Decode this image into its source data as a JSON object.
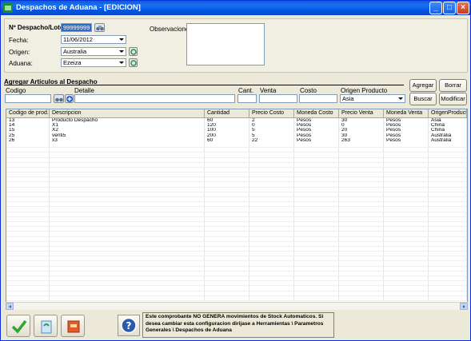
{
  "window": {
    "title": "Despachos de Aduana - [EDICION]",
    "controls": [
      "minimize",
      "maximize",
      "close"
    ]
  },
  "header": {
    "despacho_label": "Nº Despacho/Lote:",
    "despacho_value": "99999999",
    "fecha_label": "Fecha:",
    "fecha_value": "11/06/2012",
    "origen_label": "Origen:",
    "origen_value": "Australia",
    "aduana_label": "Aduana:",
    "aduana_value": "Ezeiza",
    "observaciones_label": "Observaciones:",
    "observaciones_value": ""
  },
  "agregar": {
    "section_title": "Agregar Articulos al Despacho",
    "codigo_label": "Codigo",
    "codigo_value": "",
    "detalle_label": "Detalle",
    "detalle_value": "",
    "cant_label": "Cant.",
    "cant_value": "",
    "venta_label": "Venta",
    "venta_value": "",
    "costo_label": "Costo",
    "costo_value": "",
    "origen_producto_label": "Origen Producto",
    "origen_producto_value": "Asia",
    "buttons": {
      "agregar": "Agregar",
      "borrar": "Borrar",
      "buscar": "Buscar",
      "modificar": "Modificar"
    }
  },
  "grid": {
    "columns": [
      "Codigo de prod...",
      "Descripcion",
      "Cantidad",
      "Precio Costo",
      "Moneda Costo",
      "Precio Venta",
      "Moneda Venta",
      "OrigenProducto"
    ],
    "rows": [
      [
        "13",
        "Producto Despacho",
        "60",
        "2",
        "Pesos",
        "30",
        "Pesos",
        "Asia"
      ],
      [
        "14",
        "X1",
        "120",
        "0",
        "Pesos",
        "0",
        "Pesos",
        "China"
      ],
      [
        "15",
        "X2",
        "100",
        "5",
        "Pesos",
        "20",
        "Pesos",
        "China"
      ],
      [
        "25",
        "venti5",
        "200",
        "5",
        "Pesos",
        "30",
        "Pesos",
        "Australia"
      ],
      [
        "26",
        "x3",
        "60",
        "22",
        "Pesos",
        "263",
        "Pesos",
        "Australia"
      ]
    ]
  },
  "footer": {
    "notice": "Este comprobante NO GENERA movimientos de Stock Automaticos. Si desea cambiar esta configuracion dirijase a Herramientas \\ Parametros Generales \\ Despachos de Aduana"
  },
  "colors": {
    "titlebar": "#0054e3",
    "window_bg": "#ece9d8",
    "accept_green": "#2fa82f"
  }
}
